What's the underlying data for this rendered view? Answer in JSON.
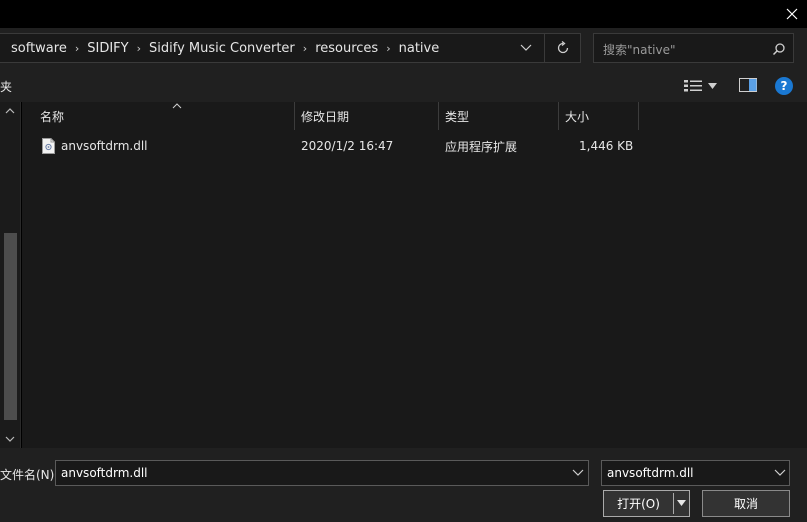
{
  "breadcrumb": {
    "items": [
      "software",
      "SIDIFY",
      "Sidify Music Converter",
      "resources",
      "native"
    ],
    "separator": "›"
  },
  "search": {
    "placeholder": "搜索\"native\""
  },
  "toolbar": {
    "left_label": "夹"
  },
  "columns": [
    {
      "key": "name",
      "label": "名称"
    },
    {
      "key": "date",
      "label": "修改日期"
    },
    {
      "key": "type",
      "label": "类型"
    },
    {
      "key": "size",
      "label": "大小"
    }
  ],
  "files": [
    {
      "name": "anvsoftdrm.dll",
      "date": "2020/1/2 16:47",
      "type": "应用程序扩展",
      "size": "1,446 KB"
    }
  ],
  "footer": {
    "filename_label": "文件名(N):",
    "filename_value": "anvsoftdrm.dll",
    "filetype_value": "anvsoftdrm.dll",
    "open_label": "打开(O)",
    "cancel_label": "取消"
  },
  "help": {
    "label": "?"
  },
  "colors": {
    "accent": "#1a78d2",
    "background": "#191919",
    "chrome": "#202020"
  }
}
